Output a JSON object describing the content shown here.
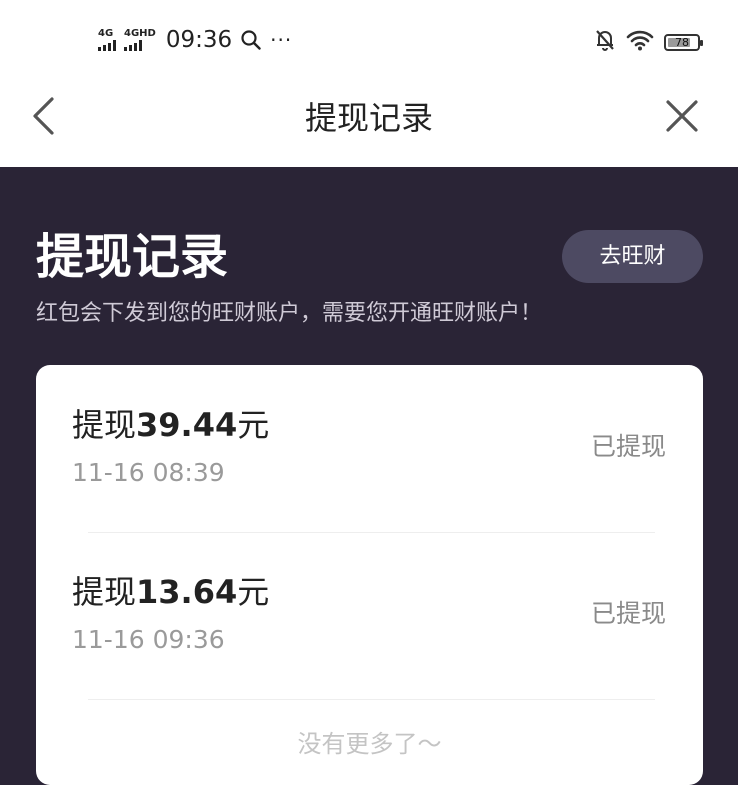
{
  "status_bar": {
    "signal1_label": "4G",
    "signal2_label": "4GHD",
    "time": "09:36",
    "more": "···",
    "battery_level": "78",
    "battery_fraction": 0.78
  },
  "navbar": {
    "title": "提现记录"
  },
  "hero": {
    "title": "提现记录",
    "subtitle": "红包会下发到您的旺财账户，需要您开通旺财账户！",
    "button_label": "去旺财"
  },
  "records": [
    {
      "prefix": "提现",
      "amount": "39.44",
      "unit": "元",
      "time": "11-16 08:39",
      "status": "已提现"
    },
    {
      "prefix": "提现",
      "amount": "13.64",
      "unit": "元",
      "time": "11-16 09:36",
      "status": "已提现"
    }
  ],
  "footer": {
    "no_more": "没有更多了～"
  }
}
